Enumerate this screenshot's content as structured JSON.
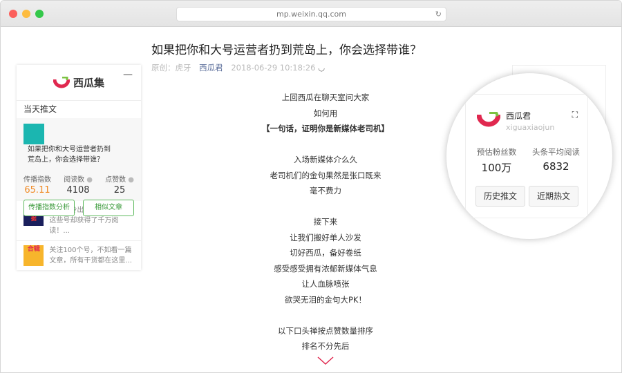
{
  "browser": {
    "url": "mp.weixin.qq.com"
  },
  "article": {
    "title": "如果把你和大号运营者扔到荒岛上，你会选择带谁？",
    "original_label": "原创：虎牙",
    "author": "西瓜君",
    "datetime": "2018-06-29 10:18:26",
    "lines": [
      "上回西瓜在聊天室问大家",
      "如何用",
      "【一句话，证明你是新媒体老司机】",
      "",
      "入场新媒体介么久",
      "老司机们的金句果然是张口既来",
      "毫不费力",
      "",
      "接下来",
      "让我们搬好单人沙发",
      "切好西瓜，备好卷纸",
      "感受感受拥有浓郁新媒体气息",
      "让人血脉喷张",
      "欲哭无泪的金句大PK！",
      "",
      "以下口头禅按点赞数量排序",
      "排名不分先后"
    ]
  },
  "left_panel": {
    "brand": "西瓜集",
    "minimize": "—",
    "section": "当天推文",
    "current": {
      "title": "如果把你和大号运营者扔到荒岛上，你会选择带谁？",
      "stats": [
        {
          "label": "传播指数",
          "value": "65.11"
        },
        {
          "label": "阅读数",
          "value": "4108"
        },
        {
          "label": "点赞数",
          "value": "25"
        }
      ],
      "buttons": [
        "传播指数分析",
        "相似文章"
      ]
    },
    "items": [
      {
        "title": "德国爆冷出局的24小时，这些号却获得了千万阅读！...",
        "thumb": "西瓜数据"
      },
      {
        "title": "关注100个号，不如看一篇文章，所有干货都在这里...",
        "thumb": "合辑"
      }
    ]
  },
  "right_card": {
    "name": "西瓜君",
    "id": "xiguaxiaojun",
    "stats": [
      {
        "label": "预估粉丝数",
        "value": "100万"
      },
      {
        "label": "头条平均阅读",
        "value": "6832"
      }
    ],
    "buttons": [
      "历史推文",
      "近期热文"
    ]
  },
  "colors": {
    "accent_green": "#5cb85c",
    "orange": "#f08a24",
    "brand_red": "#e0284f",
    "link": "#5a6d9a"
  }
}
